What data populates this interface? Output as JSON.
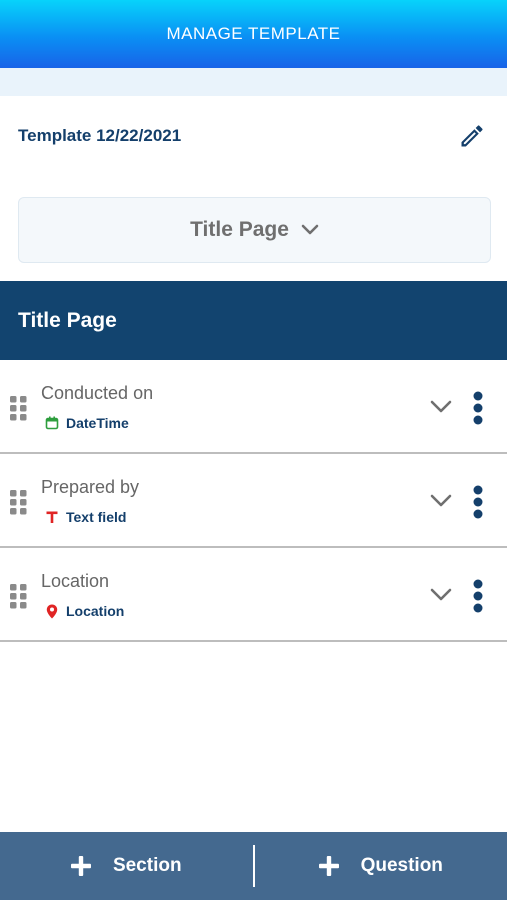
{
  "header": {
    "title": "MANAGE TEMPLATE"
  },
  "template": {
    "name": "Template 12/22/2021",
    "edit_icon": "pencil-icon"
  },
  "page_selector": {
    "selected": "Title Page",
    "icon": "chevron-down-icon"
  },
  "section": {
    "title": "Title Page"
  },
  "questions": [
    {
      "label": "Conducted on",
      "type": "DateTime",
      "type_icon": "calendar-icon",
      "type_color": "#2e9e3e"
    },
    {
      "label": "Prepared by",
      "type": "Text field",
      "type_icon": "text-t-icon",
      "type_color": "#e02424"
    },
    {
      "label": "Location",
      "type": "Location",
      "type_icon": "map-pin-icon",
      "type_color": "#e02424"
    }
  ],
  "bottom_bar": {
    "section_label": "Section",
    "question_label": "Question"
  },
  "colors": {
    "header_gradient_top": "#07d3fb",
    "header_gradient_bottom": "#1863e8",
    "navy": "#12446f",
    "bottom_bar": "#44698f"
  }
}
